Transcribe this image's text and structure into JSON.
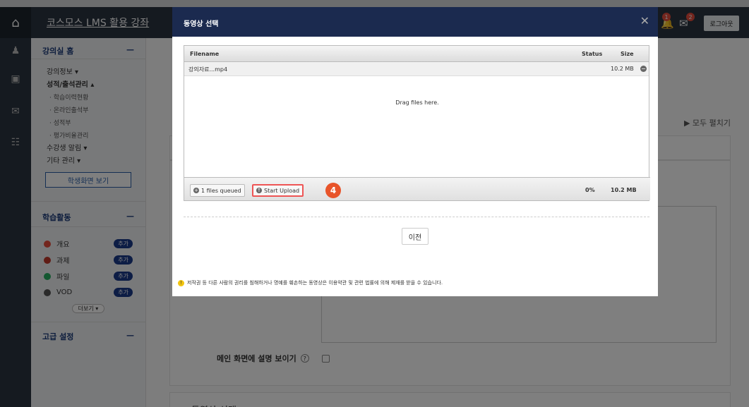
{
  "topbar": {
    "title": "코스모스 LMS 활용 강좌",
    "logout": "로그아웃",
    "badge1": "1",
    "badge2": "2",
    "home_icon": "home-icon",
    "bell_icon": "bell-icon",
    "mail_icon": "mail-icon"
  },
  "leftbar": {
    "icons": [
      "person-icon",
      "monitor-icon",
      "envelope-icon",
      "book-icon"
    ]
  },
  "sidebar": {
    "home": "강의실 홈",
    "collapse": "—",
    "items": [
      {
        "label": "강의정보 ▾"
      },
      {
        "label": "성적/출석관리 ▴"
      }
    ],
    "subs": [
      "· 학습이력현황",
      "· 온라인출석부",
      "· 성적부",
      "· 평가비율관리"
    ],
    "items2": [
      "수강생 알림 ▾",
      "기타 관리 ▾"
    ],
    "student_view": "학생화면 보기",
    "activity": "학습활동",
    "acts": [
      {
        "label": "개요",
        "color": "#e74c3c",
        "add": "추가"
      },
      {
        "label": "과제",
        "color": "#c0392b",
        "add": "추가"
      },
      {
        "label": "파일",
        "color": "#27ae60",
        "add": "추가"
      },
      {
        "label": "VOD",
        "color": "#555555",
        "add": "추가"
      }
    ],
    "more": "더보기 ▾",
    "advanced": "고급 설정"
  },
  "content": {
    "expand_all": "▶ 모두 펼치기",
    "main_desc": "메인 화면에 설명 보이기",
    "help": "?",
    "bottom_title": "동영상 선택"
  },
  "modal": {
    "title": "동영상 선택",
    "close": "✕",
    "uploader": {
      "col_filename": "Filename",
      "col_status": "Status",
      "col_size": "Size",
      "file_name": "강의자료...mp4",
      "file_size": "10.2 MB",
      "drop_text": "Drag files here.",
      "queued": "1 files queued",
      "start": "Start Upload",
      "step": "4",
      "percent": "0%",
      "total": "10.2 MB"
    },
    "prev": "이전",
    "notice": "저작권 등 다른 사람의 권리를 침해하거나 명예를 훼손하는 동영상은 이용약관 및 관련 법률에 의해 제재를 받을 수 있습니다."
  }
}
